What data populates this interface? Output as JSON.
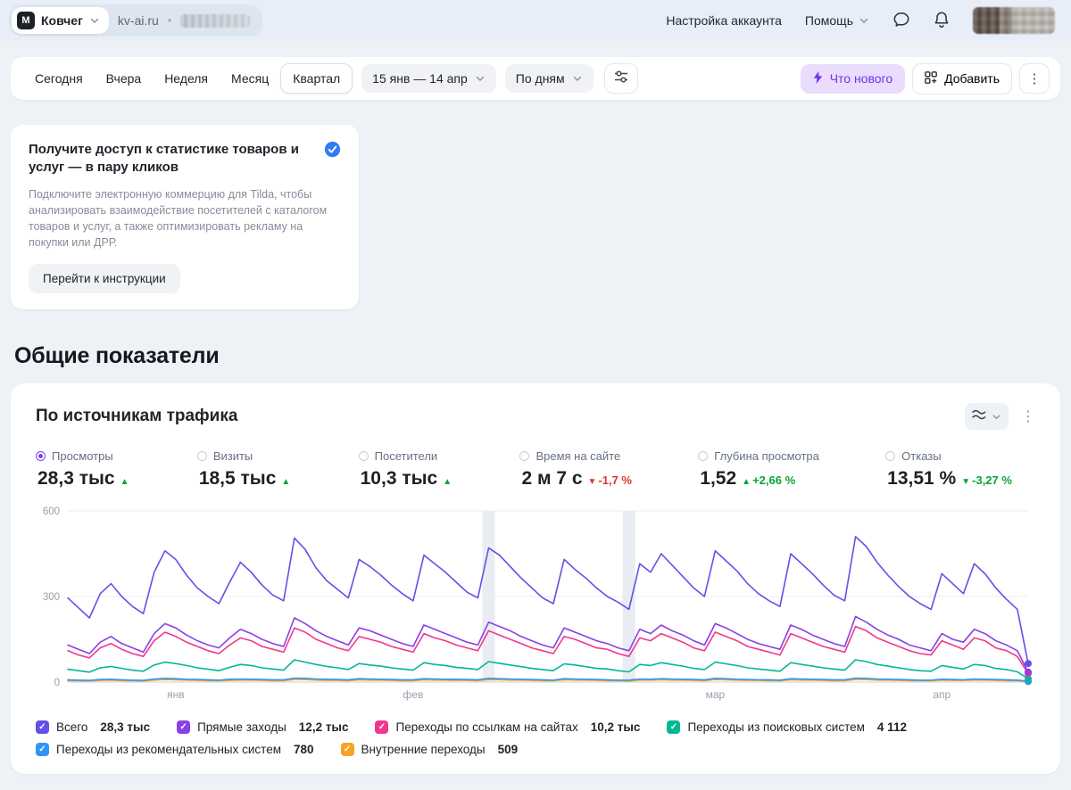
{
  "icons": {
    "check": "✓",
    "dots": "⋮",
    "logo_glyph": "M"
  },
  "topbar": {
    "counter_name": "Ковчег",
    "site": "kv-ai.ru",
    "separator": "•",
    "account_settings": "Настройка аккаунта",
    "help": "Помощь"
  },
  "toolbar": {
    "periods": [
      "Сегодня",
      "Вчера",
      "Неделя",
      "Месяц",
      "Квартал"
    ],
    "active_period": "Квартал",
    "date_range": "15 янв — 14 апр",
    "granularity": "По дням",
    "whats_new": "Что нового",
    "add": "Добавить"
  },
  "promo": {
    "title": "Получите доступ к статистике товаров и услуг — в пару кликов",
    "body": "Подключите электронную коммерцию для Tilda, чтобы анализировать взаимодействие посетителей с каталогом товаров и услуг, а также оптимизировать рекламу на покупки или ДРР.",
    "cta": "Перейти к инструкции"
  },
  "section_title": "Общие показатели",
  "widget": {
    "title": "По источникам трафика",
    "metrics": [
      {
        "label": "Просмотры",
        "value": "28,3 тыс",
        "arrow": "▲",
        "percent": "",
        "trend": "green",
        "state": "selected"
      },
      {
        "label": "Визиты",
        "value": "18,5 тыс",
        "arrow": "▲",
        "percent": "",
        "trend": "green"
      },
      {
        "label": "Посетители",
        "value": "10,3 тыс",
        "arrow": "▲",
        "percent": "",
        "trend": "green"
      },
      {
        "label": "Время на сайте",
        "value": "2 м 7 с",
        "arrow": "▼",
        "percent": "-1,7 %",
        "trend": "red"
      },
      {
        "label": "Глубина просмотра",
        "value": "1,52",
        "arrow": "▲",
        "percent": "+2,66 %",
        "trend": "green"
      },
      {
        "label": "Отказы",
        "value": "13,51 %",
        "arrow": "▼",
        "percent": "-3,27 %",
        "trend": "green"
      }
    ],
    "legend": [
      {
        "label": "Всего",
        "value": "28,3 тыс",
        "color": "#6450e8"
      },
      {
        "label": "Прямые заходы",
        "value": "12,2 тыс",
        "color": "#8b3fe8"
      },
      {
        "label": "Переходы по ссылкам на сайтах",
        "value": "10,2 тыс",
        "color": "#f2368f"
      },
      {
        "label": "Переходы из поисковых систем",
        "value": "4 112",
        "color": "#00b894"
      },
      {
        "label": "Переходы из рекомендательных систем",
        "value": "780",
        "color": "#2f96f5"
      },
      {
        "label": "Внутренние переходы",
        "value": "509",
        "color": "#f7a325"
      }
    ]
  },
  "chart_data": {
    "type": "line",
    "title": "По источникам трафика",
    "ylim": [
      0,
      600
    ],
    "yticks": [
      0,
      300,
      600
    ],
    "xtick_labels": [
      "янв",
      "фев",
      "мар",
      "апр"
    ],
    "xtick_positions": [
      10,
      32,
      60,
      81
    ],
    "highlight_days": [
      39,
      52
    ],
    "series": [
      {
        "name": "Всего",
        "color": "#6450e8",
        "values": [
          295,
          260,
          225,
          310,
          345,
          300,
          265,
          240,
          385,
          460,
          430,
          375,
          330,
          300,
          275,
          350,
          420,
          385,
          340,
          305,
          285,
          505,
          465,
          400,
          355,
          325,
          295,
          430,
          405,
          375,
          340,
          310,
          285,
          445,
          415,
          385,
          350,
          315,
          295,
          470,
          445,
          405,
          365,
          330,
          295,
          275,
          430,
          395,
          365,
          330,
          300,
          280,
          255,
          415,
          385,
          450,
          410,
          370,
          330,
          300,
          460,
          425,
          390,
          345,
          310,
          285,
          265,
          450,
          415,
          380,
          340,
          305,
          285,
          510,
          475,
          420,
          375,
          335,
          300,
          275,
          255,
          380,
          345,
          310,
          415,
          380,
          330,
          290,
          255,
          65
        ]
      },
      {
        "name": "Прямые заходы",
        "color": "#8b3fe8",
        "values": [
          130,
          115,
          100,
          140,
          160,
          135,
          120,
          105,
          170,
          205,
          190,
          165,
          145,
          130,
          120,
          155,
          185,
          170,
          150,
          135,
          125,
          225,
          205,
          180,
          160,
          145,
          130,
          190,
          180,
          165,
          150,
          135,
          125,
          200,
          185,
          170,
          155,
          140,
          130,
          210,
          195,
          180,
          160,
          145,
          130,
          120,
          190,
          175,
          160,
          145,
          135,
          120,
          110,
          185,
          170,
          200,
          180,
          165,
          145,
          130,
          205,
          190,
          170,
          150,
          135,
          125,
          115,
          200,
          185,
          165,
          150,
          135,
          125,
          230,
          210,
          185,
          165,
          150,
          130,
          120,
          110,
          170,
          150,
          140,
          185,
          170,
          145,
          130,
          110,
          35
        ]
      },
      {
        "name": "Переходы по ссылкам на сайтах",
        "color": "#f2368f",
        "values": [
          110,
          95,
          85,
          120,
          135,
          115,
          100,
          90,
          145,
          175,
          160,
          140,
          125,
          110,
          100,
          130,
          155,
          145,
          125,
          115,
          105,
          190,
          175,
          150,
          135,
          120,
          110,
          160,
          150,
          140,
          125,
          115,
          105,
          170,
          155,
          145,
          130,
          120,
          110,
          180,
          165,
          150,
          135,
          120,
          110,
          100,
          160,
          150,
          135,
          120,
          115,
          100,
          90,
          155,
          145,
          170,
          155,
          140,
          120,
          110,
          175,
          160,
          145,
          125,
          115,
          105,
          95,
          170,
          155,
          140,
          125,
          115,
          105,
          195,
          180,
          155,
          140,
          125,
          110,
          100,
          95,
          145,
          130,
          115,
          155,
          145,
          120,
          110,
          90,
          30
        ]
      },
      {
        "name": "Переходы из поисковых систем",
        "color": "#00b894",
        "values": [
          45,
          40,
          35,
          50,
          55,
          48,
          42,
          38,
          60,
          70,
          65,
          58,
          50,
          45,
          40,
          52,
          62,
          58,
          50,
          46,
          42,
          78,
          70,
          62,
          55,
          50,
          44,
          65,
          60,
          56,
          50,
          46,
          42,
          68,
          62,
          58,
          52,
          48,
          44,
          72,
          66,
          60,
          54,
          48,
          44,
          40,
          64,
          60,
          54,
          48,
          46,
          40,
          36,
          62,
          58,
          68,
          62,
          56,
          48,
          44,
          70,
          64,
          58,
          50,
          46,
          42,
          38,
          68,
          62,
          56,
          50,
          46,
          42,
          78,
          72,
          62,
          56,
          50,
          44,
          40,
          38,
          58,
          52,
          46,
          62,
          58,
          48,
          44,
          36,
          12
        ]
      },
      {
        "name": "Переходы из рекомендательных систем",
        "color": "#2f96f5",
        "values": [
          8,
          7,
          6,
          9,
          10,
          8,
          7,
          6,
          11,
          13,
          12,
          10,
          9,
          8,
          7,
          10,
          11,
          10,
          9,
          8,
          8,
          14,
          13,
          11,
          10,
          9,
          8,
          12,
          11,
          10,
          9,
          8,
          8,
          12,
          11,
          10,
          10,
          9,
          8,
          13,
          12,
          11,
          10,
          9,
          8,
          7,
          12,
          11,
          10,
          9,
          8,
          7,
          7,
          11,
          10,
          12,
          11,
          10,
          9,
          8,
          13,
          12,
          10,
          9,
          8,
          8,
          7,
          12,
          11,
          10,
          9,
          8,
          8,
          14,
          13,
          11,
          10,
          9,
          8,
          7,
          7,
          10,
          9,
          8,
          11,
          10,
          9,
          8,
          7,
          3
        ]
      },
      {
        "name": "Внутренние переходы",
        "color": "#f7a325",
        "values": [
          5,
          5,
          4,
          6,
          7,
          5,
          5,
          4,
          7,
          9,
          8,
          7,
          6,
          5,
          5,
          6,
          7,
          7,
          6,
          5,
          5,
          9,
          9,
          7,
          6,
          6,
          5,
          8,
          7,
          7,
          6,
          5,
          5,
          8,
          7,
          7,
          6,
          6,
          5,
          9,
          8,
          7,
          7,
          6,
          5,
          5,
          8,
          7,
          7,
          6,
          5,
          5,
          4,
          7,
          7,
          8,
          7,
          7,
          6,
          5,
          9,
          8,
          7,
          6,
          6,
          5,
          5,
          8,
          7,
          7,
          6,
          5,
          5,
          9,
          9,
          7,
          7,
          6,
          5,
          5,
          5,
          7,
          6,
          6,
          7,
          7,
          6,
          5,
          5,
          2
        ]
      }
    ]
  }
}
